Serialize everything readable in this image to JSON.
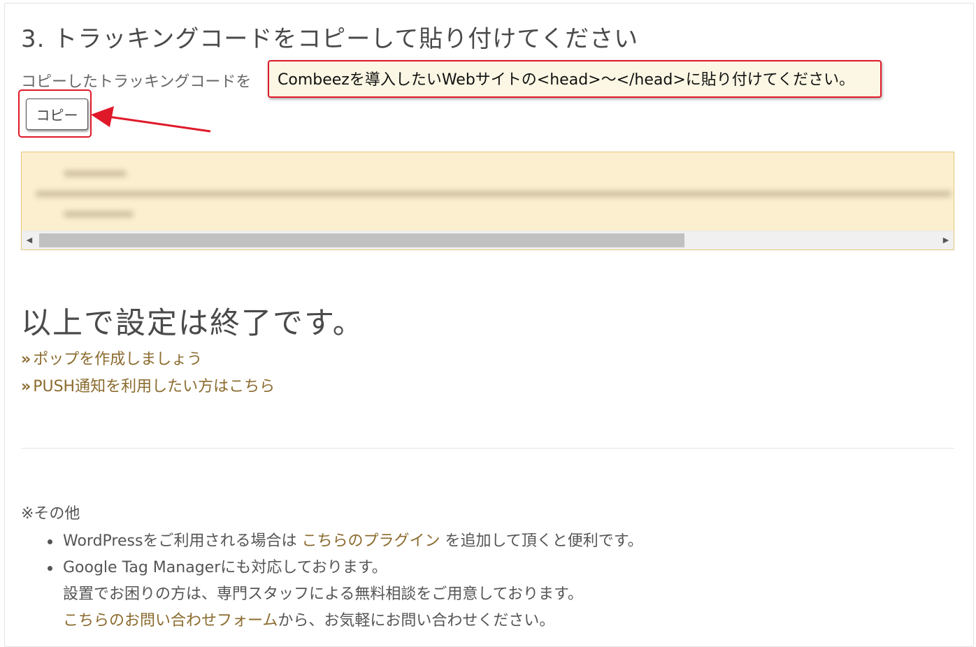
{
  "step": {
    "title": "3. トラッキングコードをコピーして貼り付けてください",
    "instruction": "コピーしたトラッキングコードを",
    "callout": "Combeezを導入したいWebサイトの<head>〜</head>に貼り付けてください。",
    "copy_button": "コピー"
  },
  "code_block": {
    "scroll_left_icon": "scroll-left-arrow",
    "scroll_right_icon": "scroll-right-arrow"
  },
  "completion": {
    "heading": "以上で設定は終了です。",
    "links": [
      {
        "chevron": "»",
        "label": "ポップを作成しましょう"
      },
      {
        "chevron": "»",
        "label": "PUSH通知を利用したい方はこちら"
      }
    ]
  },
  "other": {
    "label": "※その他",
    "wordpress": {
      "before": "WordPressをご利用される場合は",
      "link": "こちらのプラグイン",
      "after": "を追加して頂くと便利です。"
    },
    "gtm": {
      "line1": "Google Tag Managerにも対応しております。",
      "line2": "設置でお困りの方は、専門スタッフによる無料相談をご用意しております。",
      "link": "こちらのお問い合わせフォーム",
      "after": "から、お気軽にお問い合わせください。"
    }
  },
  "colors": {
    "callout_border": "#e0192a",
    "code_background": "#fcefd0",
    "link": "#8b6b2e",
    "text": "#555555"
  }
}
